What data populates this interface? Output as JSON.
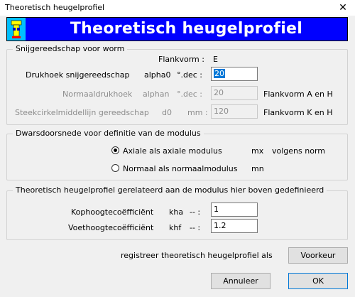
{
  "window": {
    "title": "Theoretisch heugelprofiel",
    "close_glyph": "✕"
  },
  "banner": {
    "title": "Theoretisch heugelprofiel",
    "logo_icon": "gear-tool-icon"
  },
  "group1": {
    "legend": "Snijgereedschap voor worm",
    "flankvorm_label": "Flankvorm :",
    "flankvorm_value": "E",
    "drukhoek": {
      "label": "Drukhoek snijgereedschap",
      "symbol": "alpha0",
      "unit": "°.dec :",
      "value": "20"
    },
    "normaal": {
      "label": "Normaaldrukhoek",
      "symbol": "alphan",
      "unit": "°.dec :",
      "value": "20",
      "note": "Flankvorm A en H"
    },
    "steek": {
      "label": "Steekcirkelmiddellijn gereedschap",
      "symbol": "d0",
      "unit": "mm :",
      "value": "120",
      "note": "Flankvorm K en H"
    }
  },
  "group2": {
    "legend": "Dwarsdoorsnede  voor definitie van de modulus",
    "option1": {
      "label": "Axiale als axiale modulus",
      "symbol": "mx",
      "note": "volgens norm",
      "checked": true
    },
    "option2": {
      "label": "Normaal als normaalmodulus",
      "symbol": "mn",
      "checked": false
    }
  },
  "group3": {
    "legend": "Theoretisch heugelprofiel  gerelateerd aan de modulus hier boven gedefinieerd",
    "kop": {
      "label": "Kophoogtecoëfficiënt",
      "symbol": "kha",
      "sep": "-- :",
      "value": "1"
    },
    "voet": {
      "label": "Voethoogtecoëfficiënt",
      "symbol": "khf",
      "sep": "-- :",
      "value": "1.2"
    }
  },
  "footer": {
    "register_text": "registreer theoretisch heugelprofiel als",
    "voorkeur": "Voorkeur",
    "annuleer": "Annuleer",
    "ok": "OK"
  }
}
